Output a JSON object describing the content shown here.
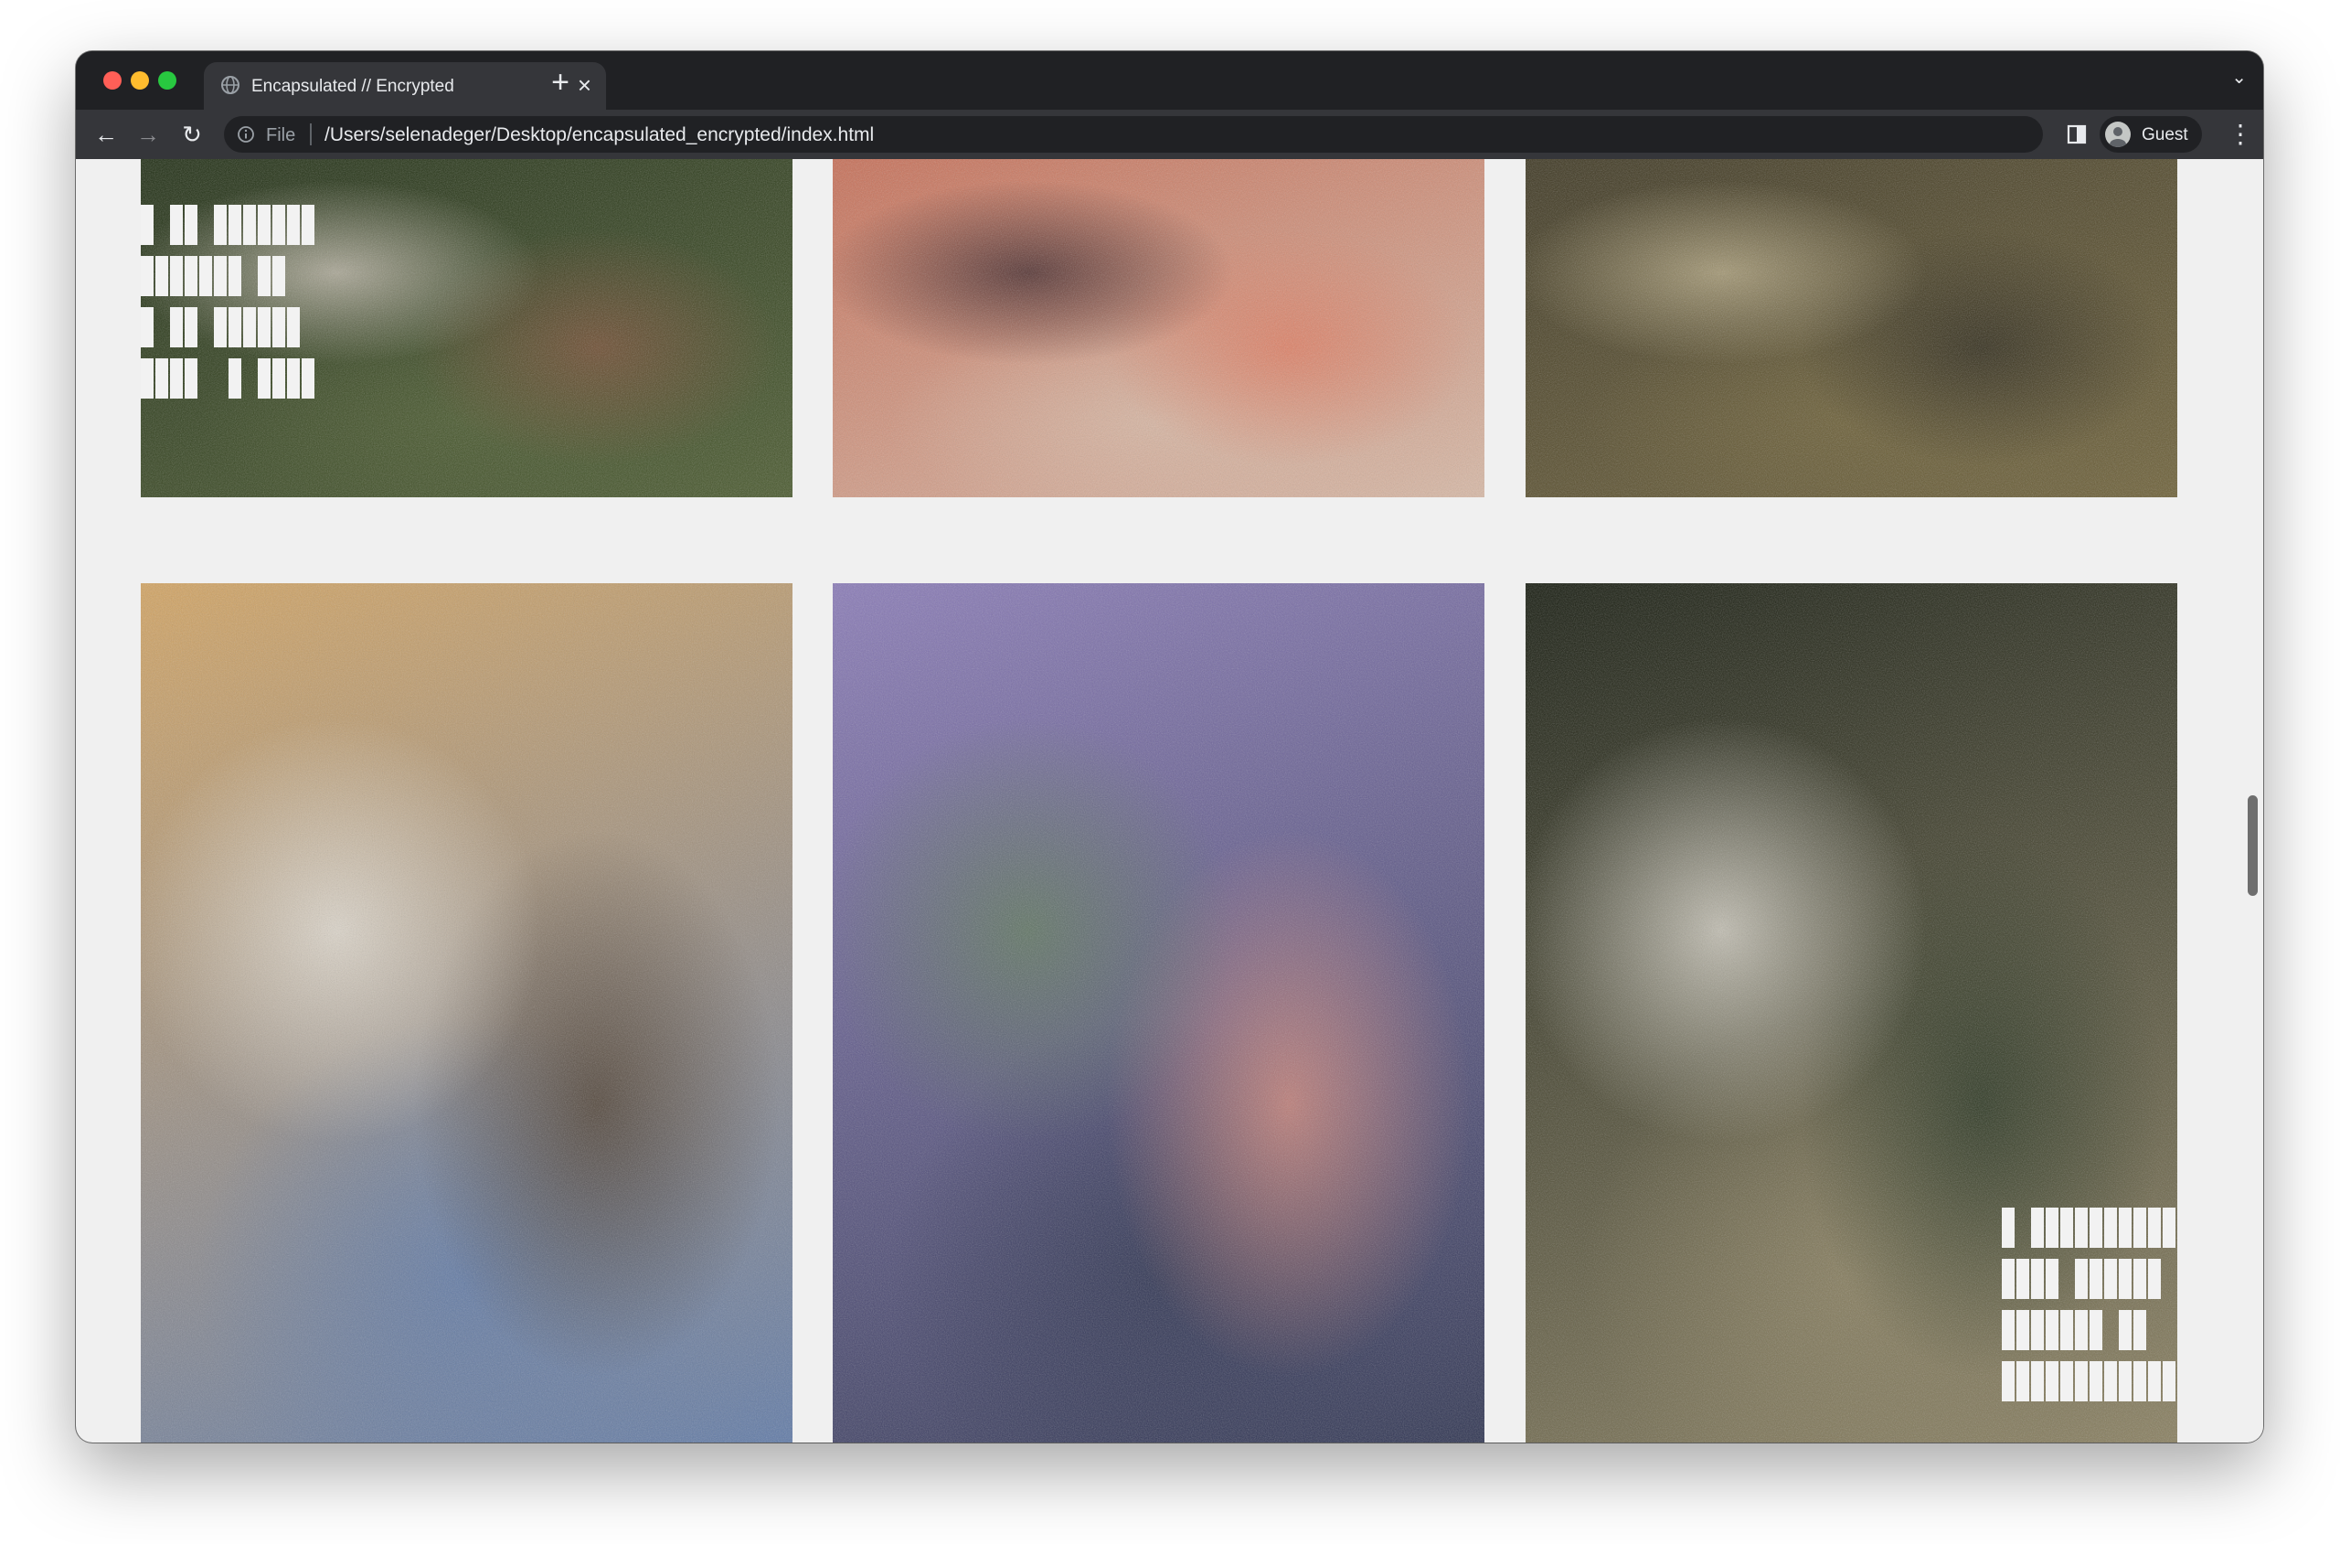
{
  "browser": {
    "tab": {
      "title": "Encapsulated // Encrypted",
      "close": "×"
    },
    "new_tab": "+",
    "tab_menu": "⌄",
    "nav": {
      "back": "←",
      "forward": "→",
      "reload": "↻"
    },
    "address": {
      "scheme": "File",
      "url": "/Users/selenadeger/Desktop/encapsulated_encrypted/index.html"
    },
    "profile": {
      "name": "Guest"
    },
    "menu": "⋮"
  },
  "gallery": {
    "items": [
      {
        "id": "row1-col1",
        "colors": [
          "#1d2b12",
          "#4a5a2e",
          "#c9c1b4",
          "#7a4e35"
        ],
        "logo": "encapsulated"
      },
      {
        "id": "row1-col2",
        "colors": [
          "#c66a52",
          "#d8b9a6",
          "#3a2226",
          "#e07a5f"
        ]
      },
      {
        "id": "row1-col3",
        "colors": [
          "#3a3420",
          "#6e6138",
          "#b8ab86",
          "#2a2618"
        ]
      },
      {
        "id": "row2-col1",
        "colors": [
          "#d3a462",
          "#5f7aa8",
          "#e8e4dc",
          "#4a3a2a"
        ]
      },
      {
        "id": "row2-col2",
        "colors": [
          "#8a7bb8",
          "#2d3350",
          "#5f7a5a",
          "#d88a7a"
        ]
      },
      {
        "id": "row2-col3",
        "colors": [
          "#151a0e",
          "#8a8060",
          "#e0dcd2",
          "#22301c"
        ],
        "logo": "encrypted"
      },
      {
        "id": "row3-col1",
        "colors": [
          "#6a6a6a",
          "#202020"
        ]
      },
      {
        "id": "row3-col2",
        "colors": [
          "#5b6a4a",
          "#8a9a70"
        ]
      },
      {
        "id": "row3-col3",
        "colors": [
          "#b8a8c8",
          "#d8c8e8"
        ]
      }
    ]
  },
  "icons": {
    "favicon": "globe-icon",
    "info": "info-icon",
    "side_panel": "side-panel-icon",
    "avatar": "person-icon"
  }
}
